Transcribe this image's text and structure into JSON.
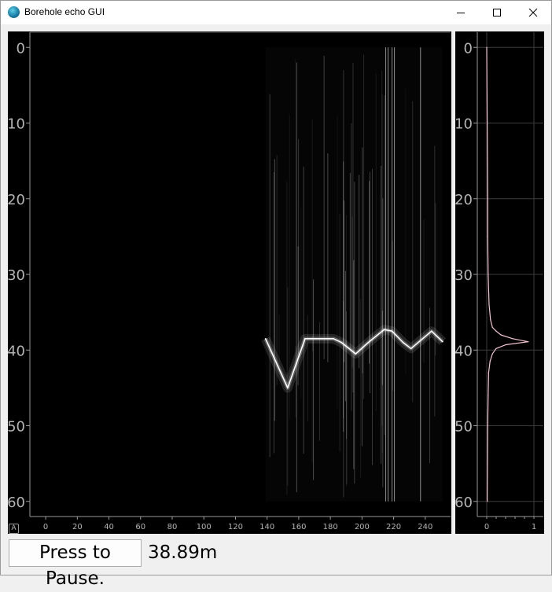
{
  "window": {
    "title": "Borehole echo GUI"
  },
  "main_plot": {
    "y_ticks": [
      "0",
      "10",
      "20",
      "30",
      "40",
      "50",
      "60"
    ],
    "x_ticks": [
      "0",
      "20",
      "40",
      "60",
      "80",
      "100",
      "120",
      "140",
      "160",
      "180",
      "200",
      "220",
      "240"
    ]
  },
  "side_plot": {
    "y_ticks": [
      "0",
      "10",
      "20",
      "30",
      "40",
      "50",
      "60"
    ],
    "x_ticks": [
      "0",
      "1"
    ]
  },
  "autorange_label": "A",
  "controls": {
    "pause_label": "Press to Pause.",
    "depth_readout": "38.89m"
  },
  "chart_data": [
    {
      "type": "heatmap",
      "title": "",
      "xlabel": "",
      "ylabel": "",
      "xlim": [
        -10,
        256
      ],
      "ylim": [
        62,
        -2
      ],
      "x_ticks": [
        0,
        20,
        40,
        60,
        80,
        100,
        120,
        140,
        160,
        180,
        200,
        220,
        240
      ],
      "y_ticks": [
        0,
        10,
        20,
        30,
        40,
        50,
        60
      ],
      "colormap": "grayscale",
      "data_x_range": [
        139,
        251
      ],
      "echo_trace": {
        "x": [
          139,
          153,
          164,
          182,
          187,
          196,
          204,
          214,
          219,
          226,
          231,
          244,
          251
        ],
        "y": [
          38.5,
          45.0,
          38.5,
          38.5,
          39.0,
          40.5,
          39.0,
          37.3,
          37.5,
          39.0,
          39.8,
          37.5,
          38.9
        ]
      },
      "grid": false
    },
    {
      "type": "line",
      "title": "",
      "xlabel": "",
      "ylabel": "",
      "xlim": [
        -0.2,
        1.2
      ],
      "ylim": [
        62,
        -2
      ],
      "x_ticks": [
        0,
        1
      ],
      "y_ticks": [
        0,
        10,
        20,
        30,
        40,
        50,
        60
      ],
      "grid": true,
      "series_color": "#f4c6d2",
      "profile": {
        "depth": [
          0,
          10,
          20,
          25,
          30,
          34,
          36,
          37,
          37.5,
          38,
          38.5,
          38.9,
          39.3,
          39.8,
          40.5,
          41.5,
          43,
          46,
          50,
          60
        ],
        "amplitude": [
          0.0,
          0.01,
          0.02,
          0.02,
          0.03,
          0.05,
          0.08,
          0.12,
          0.2,
          0.3,
          0.55,
          0.88,
          0.4,
          0.2,
          0.12,
          0.07,
          0.04,
          0.03,
          0.02,
          0.01
        ]
      }
    }
  ]
}
